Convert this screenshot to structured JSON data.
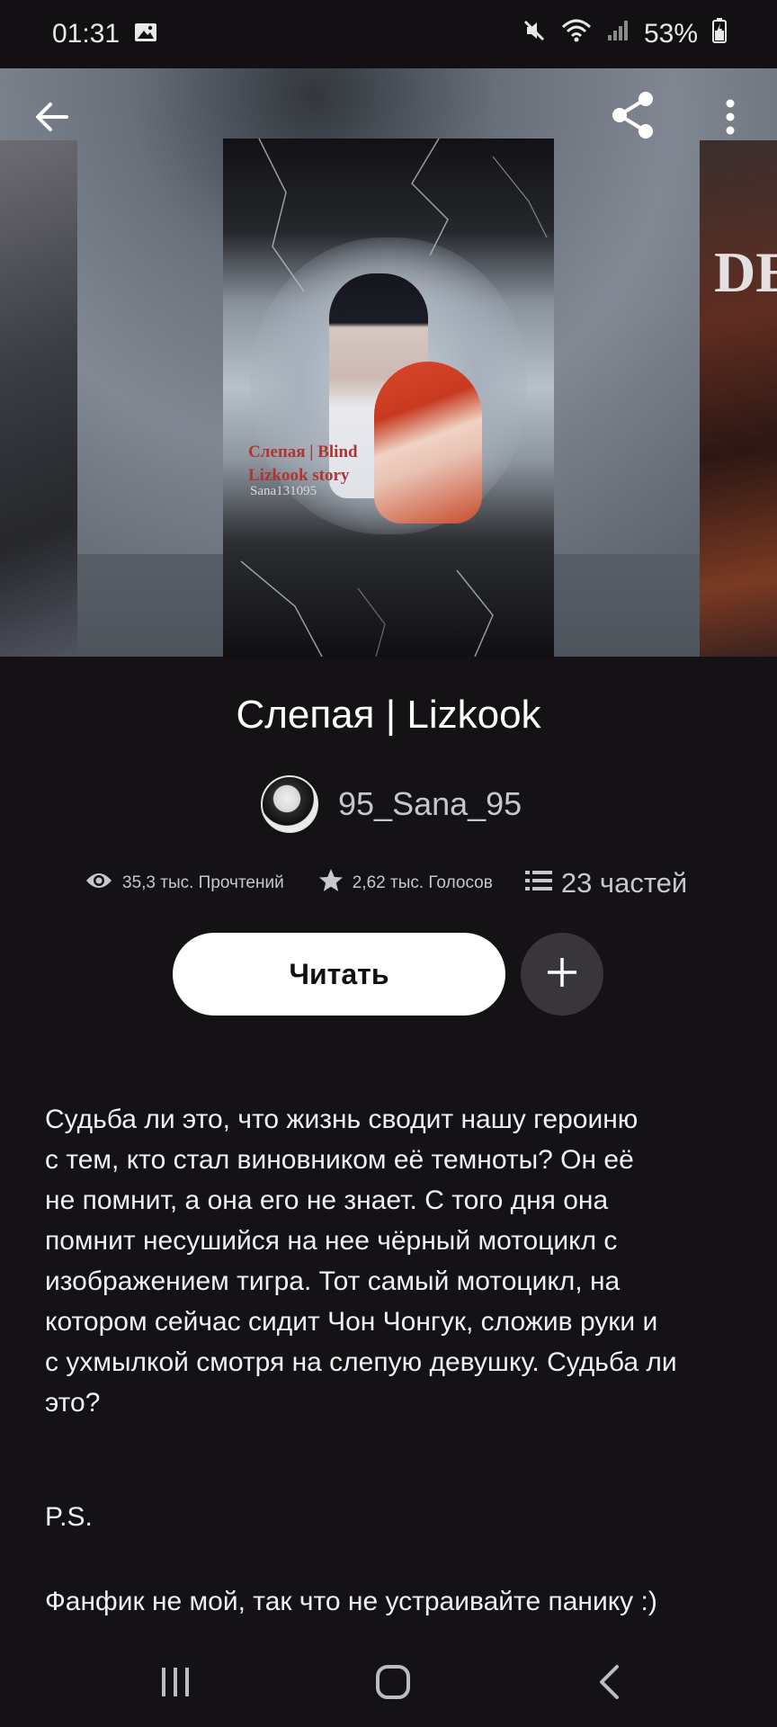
{
  "status_bar": {
    "time": "01:31",
    "battery": "53%",
    "icons": [
      "image-icon",
      "mute-icon",
      "wifi-icon",
      "signal-icon",
      "battery-icon"
    ]
  },
  "header": {
    "back_icon": "arrow-left-icon",
    "share_icon": "share-icon",
    "menu_icon": "more-vertical-icon"
  },
  "cover": {
    "title_line1": "Слепая | Blind",
    "title_line2": "Lizkook story",
    "author_mark": "Sana131095",
    "side_right_text": "DE"
  },
  "story": {
    "title": "Слепая | Lizkook",
    "author": "95_Sana_95"
  },
  "stats": {
    "reads": "35,3 тыс. Прочтений",
    "votes": "2,62 тыс. Голосов",
    "parts": "23 частей"
  },
  "actions": {
    "read_label": "Читать",
    "add_icon": "plus-icon"
  },
  "description": {
    "text": "Судьба ли это, что жизнь сводит нашу героиню\nс тем, кто стал виновником её темноты? Он её\nне помнит, а она его не знает. С того дня она\nпомнит несушийся на нее чёрный мотоцикл с\nизображением тигра. Тот самый мотоцикл, на\nкотором сейчас сидит Чон Чонгук, сложив руки и\nс ухмылкой смотря на слепую девушку. Судьба ли\nэто?",
    "ps": "P.S.",
    "note": "Фанфик не мой, так что не устраивайте панику :)"
  },
  "nav": {
    "icons": [
      "recent-apps-icon",
      "home-icon",
      "back-icon"
    ]
  }
}
